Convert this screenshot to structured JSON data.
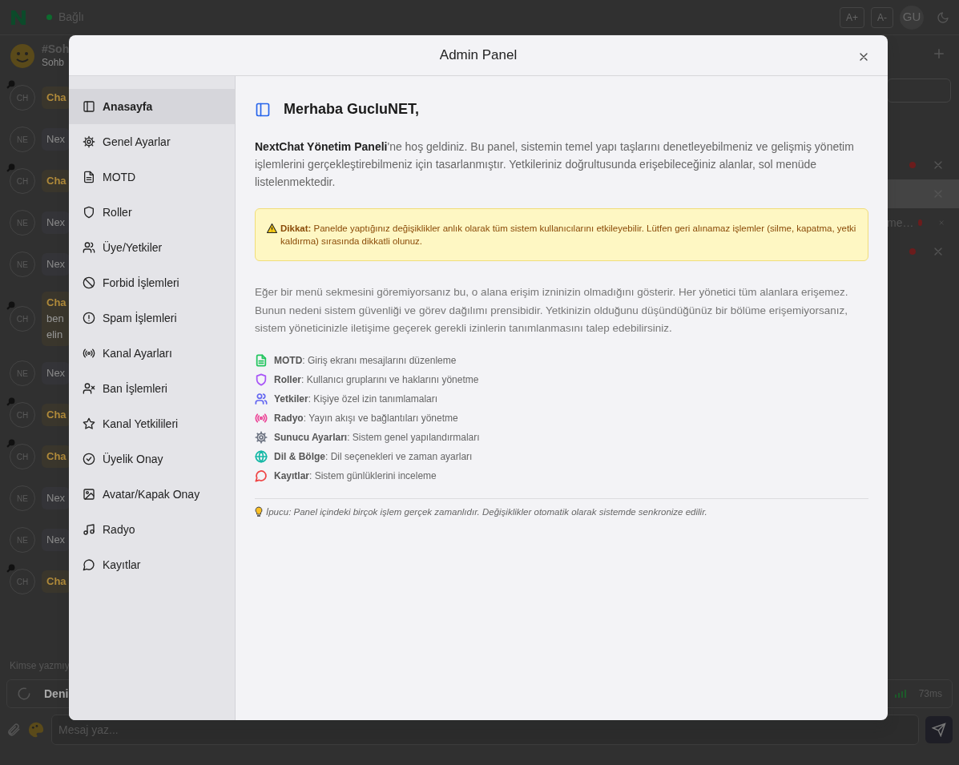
{
  "topbar": {
    "connected": true,
    "status": "Bağlı",
    "buttons": [
      "A+",
      "A-"
    ],
    "user": "GU"
  },
  "channel": {
    "name": "#Soh",
    "subtitle": "Sohb"
  },
  "messages": [
    {
      "avatar": "CH",
      "kind": "highlight",
      "lines": [
        "Cha"
      ]
    },
    {
      "avatar": "NE",
      "kind": "plain",
      "lines": [
        "Nex"
      ]
    },
    {
      "avatar": "CH",
      "kind": "highlight",
      "lines": [
        "Cha"
      ]
    },
    {
      "avatar": "NE",
      "kind": "plain",
      "lines": [
        "Nex"
      ]
    },
    {
      "avatar": "NE",
      "kind": "plain",
      "lines": [
        "Nex"
      ]
    },
    {
      "avatar": "CH",
      "kind": "highlight",
      "lines": [
        "Cha",
        "ben",
        "elin"
      ]
    },
    {
      "avatar": "NE",
      "kind": "plain",
      "lines": [
        "Nex"
      ]
    },
    {
      "avatar": "CH",
      "kind": "highlight",
      "lines": [
        "Cha"
      ]
    },
    {
      "avatar": "CH",
      "kind": "highlight",
      "lines": [
        "Cha"
      ]
    },
    {
      "avatar": "NE",
      "kind": "plain",
      "lines": [
        "Nex"
      ]
    },
    {
      "avatar": "NE",
      "kind": "plain",
      "lines": [
        "Nex"
      ]
    },
    {
      "avatar": "CH",
      "kind": "highlight",
      "lines": [
        "Cha"
      ]
    }
  ],
  "side_list": [
    {
      "unread": true,
      "selected": false
    },
    {
      "unread": false,
      "selected": true
    },
    {
      "text": "me…",
      "unread": true,
      "selected": false
    },
    {
      "unread": true,
      "selected": false
    }
  ],
  "typing": "Kimse yazmıy",
  "status_bar": {
    "name": "Deni",
    "ping": "73ms"
  },
  "composer": {
    "placeholder": "Mesaj yaz..."
  },
  "modal": {
    "title": "Admin Panel",
    "nav": [
      {
        "label": "Anasayfa",
        "selected": true
      },
      {
        "label": "Genel Ayarlar",
        "selected": false
      },
      {
        "label": "MOTD",
        "selected": false
      },
      {
        "label": "Roller",
        "selected": false
      },
      {
        "label": "Üye/Yetkiler",
        "selected": false
      },
      {
        "label": "Forbid İşlemleri",
        "selected": false
      },
      {
        "label": "Spam İşlemleri",
        "selected": false
      },
      {
        "label": "Kanal Ayarları",
        "selected": false
      },
      {
        "label": "Ban İşlemleri",
        "selected": false
      },
      {
        "label": "Kanal Yetkilileri",
        "selected": false
      },
      {
        "label": "Üyelik Onay",
        "selected": false
      },
      {
        "label": "Avatar/Kapak Onay",
        "selected": false
      },
      {
        "label": "Radyo",
        "selected": false
      },
      {
        "label": "Kayıtlar",
        "selected": false
      }
    ],
    "greeting": "Merhaba GucluNET,",
    "intro": "**NextChat Yönetim Paneli**'ne hoş geldiniz. Bu panel, sistemin temel yapı taşlarını denetleyebilmeniz ve gelişmiş yönetim işlemlerini gerçekleştirebilmeniz için tasarlanmıştır. Yetkileriniz doğrultusunda erişebileceğiniz alanlar, sol menüde listelenmektedir.",
    "alert": "**Dikkat:** Panelde yaptığınız değişiklikler anlık olarak tüm sistem kullanıcılarını etkileyebilir. Lütfen geri alınamaz işlemler (silme, kapatma, yetki kaldırma) sırasında dikkatli olunuz.",
    "info": "Eğer bir menü sekmesini göremiyorsanız bu, o alana erişim izninizin olmadığını gösterir. Her yönetici tüm alanlara erişemez. Bunun nedeni sistem güvenliği ve görev dağılımı prensibidir. Yetkinizin olduğunu düşündüğünüz bir bölüme erişemiyorsanız, sistem yöneticinizle iletişime geçerek gerekli izinlerin tanımlanmasını talep edebilirsiniz.",
    "features": [
      {
        "text": "**MOTD**: Giriş ekranı mesajlarını düzenleme",
        "color": "#22c55e"
      },
      {
        "text": "**Roller**: Kullanıcı gruplarını ve haklarını yönetme",
        "color": "#a855f7"
      },
      {
        "text": "**Yetkiler**: Kişiye özel izin tanımlamaları",
        "color": "#6366f1"
      },
      {
        "text": "**Radyo**: Yayın akışı ve bağlantıları yönetme",
        "color": "#ec4899"
      },
      {
        "text": "**Sunucu Ayarları**: Sistem genel yapılandırmaları",
        "color": "#6b7280"
      },
      {
        "text": "**Dil & Bölge**: Dil seçenekleri ve zaman ayarları",
        "color": "#14b8a6"
      },
      {
        "text": "**Kayıtlar**: Sistem günlüklerini inceleme",
        "color": "#ef4444"
      }
    ],
    "tip": "İpucu: Panel içindeki birçok işlem gerçek zamanlıdır. Değişiklikler otomatik olarak sistemde senkronize edilir."
  }
}
